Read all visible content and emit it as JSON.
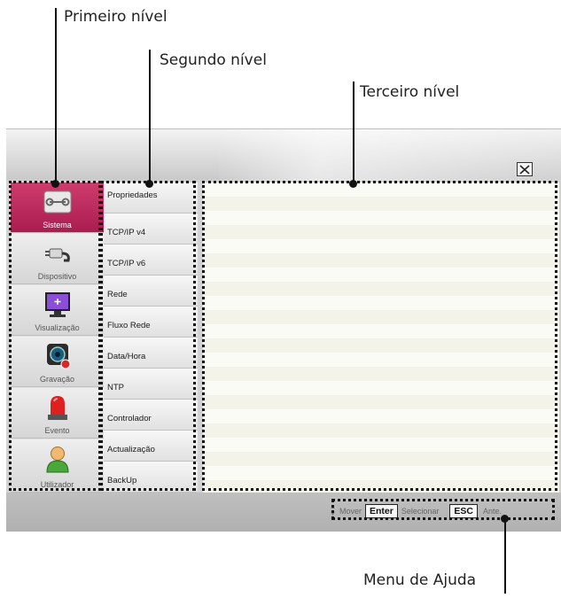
{
  "callouts": {
    "first_level": "Primeiro nível",
    "second_level": "Segundo nível",
    "third_level": "Terceiro nível",
    "help_menu": "Menu de Ajuda"
  },
  "window": {
    "close_icon": "close-x-icon"
  },
  "first_level": {
    "selected": "Sistema",
    "items": [
      {
        "label": "Sistema",
        "icon": "wrench-icon"
      },
      {
        "label": "Dispositivo",
        "icon": "plug-icon"
      },
      {
        "label": "Visualização",
        "icon": "monitor-icon"
      },
      {
        "label": "Gravação",
        "icon": "camera-record-icon"
      },
      {
        "label": "Evento",
        "icon": "siren-icon"
      },
      {
        "label": "Utilizador",
        "icon": "user-icon"
      }
    ]
  },
  "second_level": {
    "items": [
      {
        "label": "Propriedades"
      },
      {
        "label": "TCP/IP v4"
      },
      {
        "label": "TCP/IP v6"
      },
      {
        "label": "Rede"
      },
      {
        "label": "Fluxo Rede"
      },
      {
        "label": "Data/Hora"
      },
      {
        "label": "NTP"
      },
      {
        "label": "Controlador"
      },
      {
        "label": "Actualização"
      },
      {
        "label": "BackUp"
      }
    ]
  },
  "help_bar": {
    "move_label": "Mover",
    "enter_key": "Enter",
    "select_label": "Selecionar",
    "esc_key": "ESC",
    "back_label": "Ante."
  },
  "colors": {
    "accent_active": "#b8265a",
    "window_bg": "#d2d2d2"
  }
}
